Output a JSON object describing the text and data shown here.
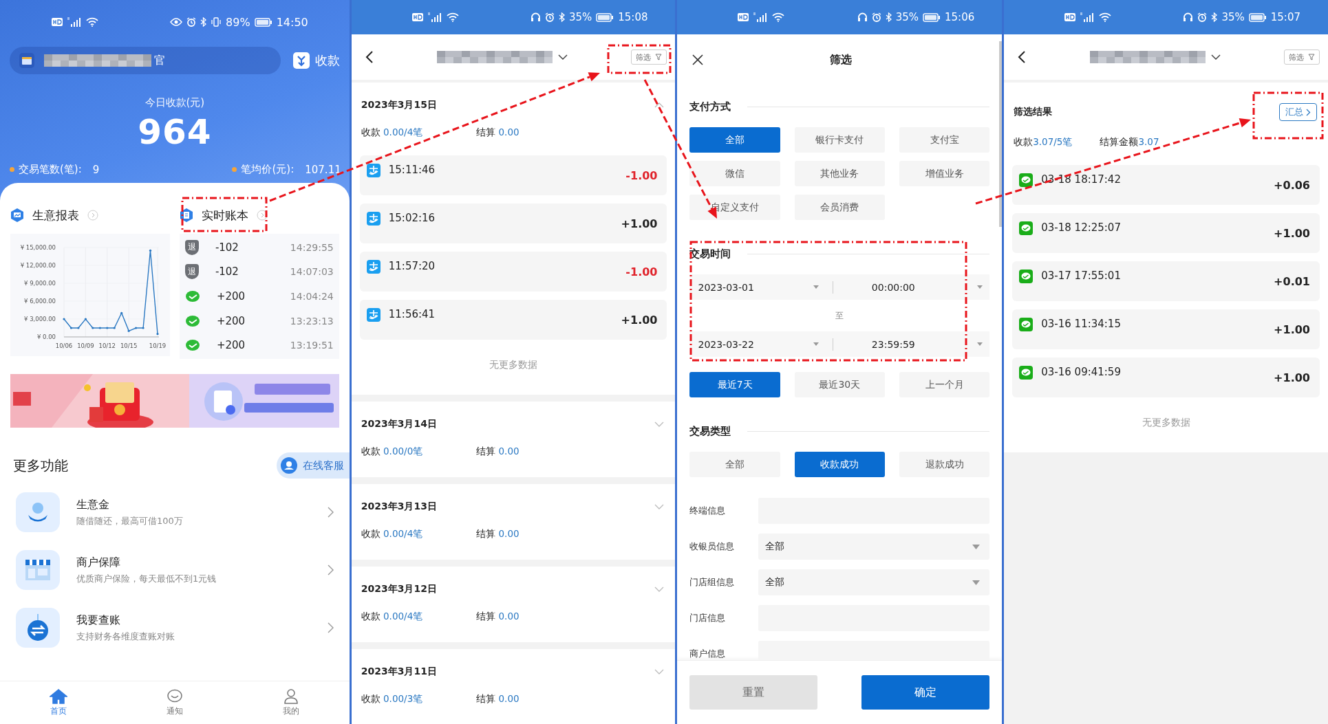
{
  "home_screen": {
    "status_bar": {
      "battery": "89%",
      "time": "14:50"
    },
    "merchant": {
      "name_tail": "官"
    },
    "collect_button": "收款",
    "today_label": "今日收款(元)",
    "today_amount": "964",
    "stats": [
      {
        "label": "交易笔数(笔):",
        "value": "9"
      },
      {
        "label": "笔均价(元):",
        "value": "107.11"
      }
    ],
    "report": {
      "title": "生意报表",
      "chart_data": {
        "type": "line",
        "categories": [
          "10/06",
          null,
          null,
          "10/09",
          null,
          null,
          "10/12",
          null,
          null,
          "10/15",
          null,
          null,
          null,
          "10/19"
        ],
        "series": [
          {
            "color": "#2a78c2",
            "values": [
              3000,
              1500,
              1500,
              3000,
              1500,
              1500,
              1500,
              1500,
              4000,
              1000,
              1500,
              1500,
              14500,
              500
            ]
          }
        ],
        "ylim": [
          0,
          15000
        ],
        "grid": true,
        "yticks": [
          {
            "value": 0,
            "label": "¥ 0.00"
          },
          {
            "value": 3000,
            "label": "¥ 3,000.00"
          },
          {
            "value": 6000,
            "label": "¥ 6,000.00"
          },
          {
            "value": 9000,
            "label": "¥ 9,000.00"
          },
          {
            "value": 12000,
            "label": "¥ 12,000.00"
          },
          {
            "value": 15000,
            "label": "¥ 15,000.00"
          }
        ]
      }
    },
    "ledger": {
      "title": "实时账本",
      "entries": [
        {
          "kind": "refund",
          "badge": "退",
          "amount": "-102",
          "time": "14:29:55"
        },
        {
          "kind": "refund",
          "badge": "退",
          "amount": "-102",
          "time": "14:07:03"
        },
        {
          "kind": "wechat",
          "amount": "+200",
          "time": "14:04:24"
        },
        {
          "kind": "wechat",
          "amount": "+200",
          "time": "13:23:13"
        },
        {
          "kind": "wechat",
          "amount": "+200",
          "time": "13:19:51"
        }
      ]
    },
    "more": {
      "title": "更多功能",
      "support_button": "在线客服",
      "items": [
        {
          "title": "生意金",
          "subtitle": "随借随还，最高可借100万"
        },
        {
          "title": "商户保障",
          "subtitle": "优质商户保险，每天最低不到1元钱"
        },
        {
          "title": "我要查账",
          "subtitle": "支持财务各维度查账对账"
        }
      ]
    },
    "tab_bar": [
      {
        "label": "首页",
        "selected": true
      },
      {
        "label": "通知",
        "selected": false
      },
      {
        "label": "我的",
        "selected": false
      }
    ]
  },
  "records_screen": {
    "status_bar": {
      "battery": "35%",
      "time": "15:08"
    },
    "filter_button": "筛选",
    "days": [
      {
        "date": "2023年3月15日",
        "expanded": true,
        "income_label": "收款",
        "income": "0.00/4笔",
        "settle_label": "结算",
        "settle": "0.00",
        "transactions": [
          {
            "time": "15:11:46",
            "amount": "-1.00",
            "negative": true
          },
          {
            "time": "15:02:16",
            "amount": "+1.00",
            "negative": false
          },
          {
            "time": "11:57:20",
            "amount": "-1.00",
            "negative": true
          },
          {
            "time": "11:56:41",
            "amount": "+1.00",
            "negative": false
          }
        ],
        "end_note": "无更多数据"
      },
      {
        "date": "2023年3月14日",
        "expanded": false,
        "income_label": "收款",
        "income": "0.00/0笔",
        "settle_label": "结算",
        "settle": "0.00"
      },
      {
        "date": "2023年3月13日",
        "expanded": false,
        "income_label": "收款",
        "income": "0.00/4笔",
        "settle_label": "结算",
        "settle": "0.00"
      },
      {
        "date": "2023年3月12日",
        "expanded": false,
        "income_label": "收款",
        "income": "0.00/4笔",
        "settle_label": "结算",
        "settle": "0.00"
      },
      {
        "date": "2023年3月11日",
        "expanded": false,
        "income_label": "收款",
        "income": "0.00/3笔",
        "settle_label": "结算",
        "settle": "0.00"
      }
    ]
  },
  "filter_screen": {
    "status_bar": {
      "battery": "35%",
      "time": "15:06"
    },
    "title": "筛选",
    "payment": {
      "title": "支付方式",
      "options": [
        {
          "label": "全部",
          "selected": true
        },
        {
          "label": "银行卡支付",
          "selected": false
        },
        {
          "label": "支付宝",
          "selected": false
        },
        {
          "label": "微信",
          "selected": false
        },
        {
          "label": "其他业务",
          "selected": false
        },
        {
          "label": "增值业务",
          "selected": false
        },
        {
          "label": "自定义支付",
          "selected": false
        },
        {
          "label": "会员消费",
          "selected": false
        }
      ]
    },
    "time": {
      "title": "交易时间",
      "start": {
        "date": "2023-03-01",
        "time": "00:00:00"
      },
      "separator": "至",
      "end": {
        "date": "2023-03-22",
        "time": "23:59:59"
      },
      "presets": [
        {
          "label": "最近7天",
          "selected": true
        },
        {
          "label": "最近30天",
          "selected": false
        },
        {
          "label": "上一个月",
          "selected": false
        }
      ]
    },
    "type": {
      "title": "交易类型",
      "options": [
        {
          "label": "全部",
          "selected": false
        },
        {
          "label": "收款成功",
          "selected": true
        },
        {
          "label": "退款成功",
          "selected": false
        }
      ]
    },
    "fields": [
      {
        "label": "终端信息",
        "kind": "text"
      },
      {
        "label": "收银员信息",
        "kind": "select",
        "value": "全部"
      },
      {
        "label": "门店组信息",
        "kind": "select",
        "value": "全部"
      },
      {
        "label": "门店信息",
        "kind": "text"
      },
      {
        "label": "商户信息",
        "kind": "text"
      }
    ],
    "reset_button": "重置",
    "confirm_button": "确定"
  },
  "result_screen": {
    "status_bar": {
      "battery": "35%",
      "time": "15:07"
    },
    "filter_button": "筛选",
    "title": "筛选结果",
    "summary_button": "汇总",
    "income_label": "收款",
    "income": "3.07/5笔",
    "settle_label": "结算金额",
    "settle": "3.07",
    "transactions": [
      {
        "time": "03-18 18:17:42",
        "amount": "+0.06"
      },
      {
        "time": "03-18 12:25:07",
        "amount": "+1.00"
      },
      {
        "time": "03-17 17:55:01",
        "amount": "+0.01"
      },
      {
        "time": "03-16 11:34:15",
        "amount": "+1.00"
      },
      {
        "time": "03-16 09:41:59",
        "amount": "+1.00"
      }
    ],
    "end_note": "无更多数据"
  }
}
